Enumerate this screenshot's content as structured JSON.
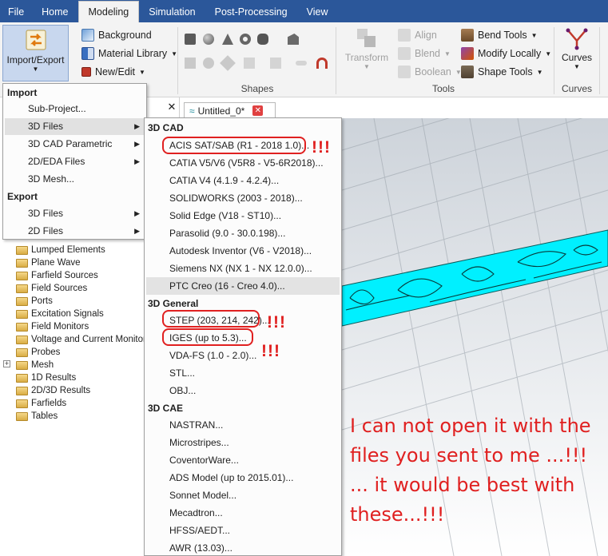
{
  "menubar": {
    "tabs": [
      "File",
      "Home",
      "Modeling",
      "Simulation",
      "Post-Processing",
      "View"
    ],
    "active_index": 2
  },
  "ribbon": {
    "import_export_label": "Import/Export",
    "background_label": "Background",
    "material_library_label": "Material Library",
    "new_edit_label": "New/Edit",
    "shapes_group_label": "Shapes",
    "transform_label": "Transform",
    "align_label": "Align",
    "blend_label": "Blend",
    "boolean_label": "Boolean",
    "bend_tools_label": "Bend Tools",
    "modify_locally_label": "Modify Locally",
    "shape_tools_label": "Shape Tools",
    "tools_group_label": "Tools",
    "curves_label": "Curves",
    "curves_group_label": "Curves"
  },
  "import_menu": {
    "import_header": "Import",
    "export_header": "Export",
    "import_items": [
      "Sub-Project...",
      "3D Files",
      "3D CAD Parametric",
      "2D/EDA Files",
      "3D Mesh..."
    ],
    "export_items": [
      "3D Files",
      "2D Files"
    ]
  },
  "submenu": {
    "cad_header": "3D CAD",
    "cad_items": [
      "ACIS SAT/SAB (R1 - 2018 1.0)...",
      "CATIA V5/V6 (V5R8 - V5-6R2018)...",
      "CATIA V4 (4.1.9 - 4.2.4)...",
      "SOLIDWORKS (2003 - 2018)...",
      "Solid Edge (V18 - ST10)...",
      "Parasolid (9.0 - 30.0.198)...",
      "Autodesk Inventor (V6 - V2018)...",
      "Siemens NX (NX 1 - NX 12.0.0)...",
      "PTC Creo (16 - Creo 4.0)..."
    ],
    "general_header": "3D General",
    "general_items": [
      "STEP (203, 214, 242)...",
      "IGES (up to 5.3)...",
      "VDA-FS (1.0 - 2.0)...",
      "STL...",
      "OBJ..."
    ],
    "cae_header": "3D CAE",
    "cae_items": [
      "NASTRAN...",
      "Microstripes...",
      "CoventorWare...",
      "ADS Model (up to 2015.01)...",
      "Sonnet Model...",
      "Mecadtron...",
      "HFSS/AEDT...",
      "AWR (13.03)..."
    ]
  },
  "tree": {
    "items": [
      "Lumped Elements",
      "Plane Wave",
      "Farfield Sources",
      "Field Sources",
      "Ports",
      "Excitation Signals",
      "Field Monitors",
      "Voltage and Current Monitors",
      "Probes",
      "Mesh",
      "1D Results",
      "2D/3D Results",
      "Farfields",
      "Tables"
    ]
  },
  "doc_tab": {
    "label": "Untitled_0*"
  },
  "annotations": {
    "bangs": "!!!",
    "note_lines": [
      "I can not open it with the",
      "files you sent to me ...!!!",
      "... it would be best with",
      "these...!!!"
    ]
  },
  "colors": {
    "accent": "#2b579a",
    "annotation": "#e02020",
    "model": "#00f0ff"
  }
}
